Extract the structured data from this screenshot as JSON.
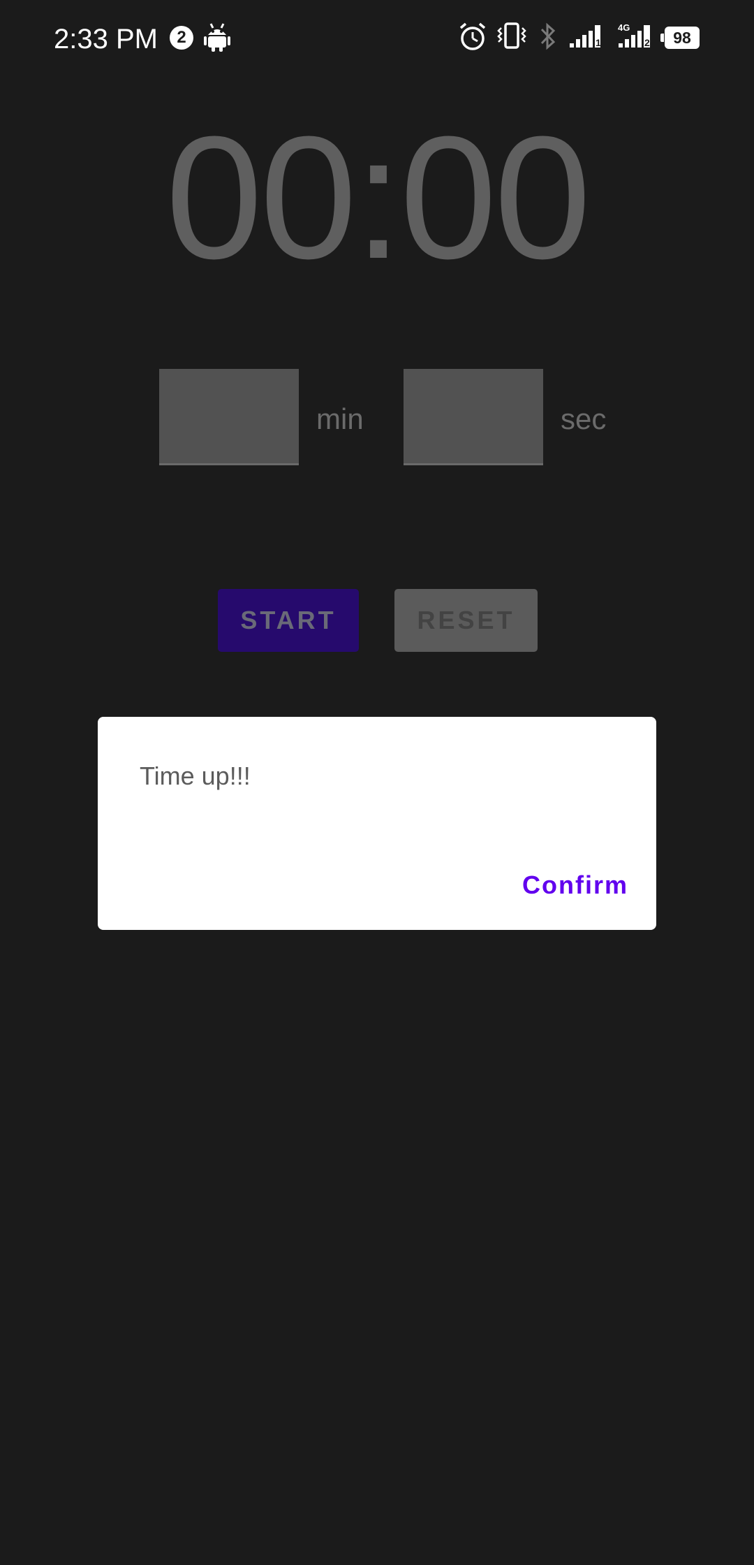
{
  "status_bar": {
    "time": "2:33 PM",
    "notification_count": "2",
    "battery_level": "98",
    "icons": [
      "android-icon",
      "alarm-icon",
      "vibrate-icon",
      "bluetooth-icon",
      "signal-1-icon",
      "signal-4g-2-icon",
      "battery-icon"
    ]
  },
  "timer": {
    "display": "00:00",
    "minutes_value": "",
    "seconds_value": "",
    "minutes_unit": "min",
    "seconds_unit": "sec"
  },
  "buttons": {
    "start_label": "START",
    "reset_label": "RESET"
  },
  "dialog": {
    "message": "Time up!!!",
    "confirm_label": "Confirm"
  },
  "colors": {
    "background": "#1b1b1b",
    "accent": "#6200ee",
    "start_button": "#260a6d",
    "timer_text": "#5f5f5f"
  }
}
